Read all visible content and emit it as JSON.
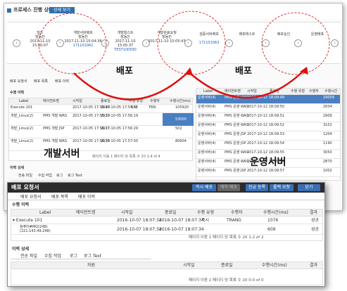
{
  "back_window": {
    "title": "프로세스 진행 상태",
    "detail_button": "상세 보기",
    "steps": [
      {
        "name": "빌드",
        "user": "장동진",
        "time": "2017-11-10 15:00:07",
        "id": ""
      },
      {
        "name": "개발서버배포",
        "user": "장동진",
        "time": "2017-11-10 15:04:38",
        "id": "171101062"
      },
      {
        "name": "개발테스트",
        "user": "장동진",
        "time": "2017-11-10 15:05:37",
        "id": "TEST100590"
      },
      {
        "name": "개발완료요청",
        "user": "장동진",
        "time": "2017-11-10 15:05:43",
        "id": ""
      },
      {
        "name": "검증서버배포",
        "user": "",
        "time": "",
        "id": "171101063"
      },
      {
        "name": "배포테스트",
        "user": "",
        "time": "",
        "id": ""
      },
      {
        "name": "배포승인",
        "user": "",
        "time": "",
        "id": ""
      },
      {
        "name": "운영배포",
        "user": "",
        "time": "",
        "id": ""
      }
    ],
    "tabs": [
      "배포 요청서",
      "배포 목록",
      "배포 이력"
    ],
    "section_title": "수행 이력",
    "columns": [
      "Label",
      "에이전트명",
      "시작일",
      "종료일",
      "수행 유형",
      "수행자",
      "수행시간(ms)"
    ],
    "rows": [
      {
        "label": "Execute 101",
        "agent": "",
        "start": "2017-10-05 17:50:40",
        "end": "2017-10-05 17:57:56",
        "type": "축사",
        "user": "TBN",
        "ms": "105920"
      },
      {
        "label": "개발_Linux(2)",
        "agent": "PMS 개발 WAS",
        "start": "2017-10-05 17:55:33",
        "end": "2017-10-05 17:56:19",
        "type": "",
        "user": "",
        "ms": "53000"
      },
      {
        "label": "개발_Linux(2)",
        "agent": "PMS 개발 JSP",
        "start": "2017-10-05 17:56:27",
        "end": "2017-10-05 17:56:29",
        "type": "",
        "user": "",
        "ms": "502"
      },
      {
        "label": "개발_Linux(2)",
        "agent": "PMS 개발 WAS",
        "start": "2017-10-05 17:56:30",
        "end": "2017-10-05 17:57:50",
        "type": "",
        "user": "",
        "ms": "80604"
      }
    ],
    "right_columns": [
      "Label",
      "에이전트명",
      "시작일",
      "종료일",
      "수행 유형",
      "수행자",
      "수행시간"
    ],
    "right_rows": [
      {
        "label": "운영서버(4)",
        "agent": "PMS 운영 WAS",
        "start": "2017-10-12 18:09:49",
        "ms": "29009"
      },
      {
        "label": "운영서버(4)",
        "agent": "PMS 운영 WAS",
        "start": "2017-10-12 18:09:50",
        "ms": "2834"
      },
      {
        "label": "운영서버(4)",
        "agent": "PMS 운영 WAS",
        "start": "2017-10-12 18:09:51",
        "ms": "2909"
      },
      {
        "label": "운영서버(4)",
        "agent": "PMS 운영 WAS",
        "start": "2017-10-12 18:09:52",
        "ms": "3101"
      },
      {
        "label": "운영서버(4)",
        "agent": "PMS 운영 JSP",
        "start": "2017-10-12 18:09:53",
        "ms": "1204"
      },
      {
        "label": "운영서버(4)",
        "agent": "PMS 운영 JSP",
        "start": "2017-10-12 18:09:54",
        "ms": "1190"
      },
      {
        "label": "운영서버(4)",
        "agent": "PMS 운영 WAS",
        "start": "2017-10-12 18:09:55",
        "ms": "3050"
      },
      {
        "label": "운영서버(4)",
        "agent": "PMS 운영 WAS",
        "start": "2017-10-12 18:09:56",
        "ms": "2870"
      },
      {
        "label": "운영서버(4)",
        "agent": "PMS 운영 JSP",
        "start": "2017-10-12 18:09:57",
        "ms": "1002"
      }
    ],
    "pager_left": "페이지 이동  1 페이지 당 목록 수  20  1-4 of 4",
    "pager_right": "페이지 당 목록 수  20",
    "detail_section": "이력 상세",
    "detail_tabs": [
      "전송 파일",
      "수집 작업",
      "로그",
      "로그 Text"
    ]
  },
  "annotations": {
    "deploy_left": "배포",
    "deploy_right": "배포",
    "dev_server": "개발서버",
    "prod_server": "운영서버"
  },
  "front_window": {
    "title": "배포 요청서",
    "header_buttons": [
      "즉시 배포",
      "예약 배포",
      "진급 등록",
      "롤백 요청",
      "닫기"
    ],
    "tabs": [
      "배포 요청서",
      "배포 목록",
      "배포 이력"
    ],
    "section_title": "수행 이력",
    "columns": [
      "Label",
      "에이전트명",
      "시작일",
      "종료일",
      "수행 유형",
      "수행자",
      "수행시간(ms)",
      "결과"
    ],
    "rows": [
      {
        "label": "▾ Execute 101",
        "agent": "",
        "start": "2016-10-07 18:07:34",
        "end": "2016-10-07 18:07:34",
        "type": "즉시",
        "user": "TRANG",
        "ms": "1076",
        "result": "성공"
      },
      {
        "label": "컴퓨터#MO(248)\n(221.143.49.248)",
        "agent": "",
        "start": "2016-10-07 18:07:34",
        "end": "2016-10-07 18:07:34",
        "type": "",
        "user": "",
        "ms": "609",
        "result": "성공"
      }
    ],
    "pager": "페이지 이동  1 페이지 당 목록 수  20  1-2 of 2",
    "detail_section": "이력 상세",
    "detail_tabs": [
      "전송 파일",
      "수집 작업",
      "로그",
      "로그 Text"
    ],
    "detail_columns": [
      "자원",
      "시작일",
      "종료일",
      "수행시간(ms)",
      "결과"
    ],
    "detail_pager": "페이지 이동  1 페이지 당 목록 수  20  0-0 of 0"
  }
}
